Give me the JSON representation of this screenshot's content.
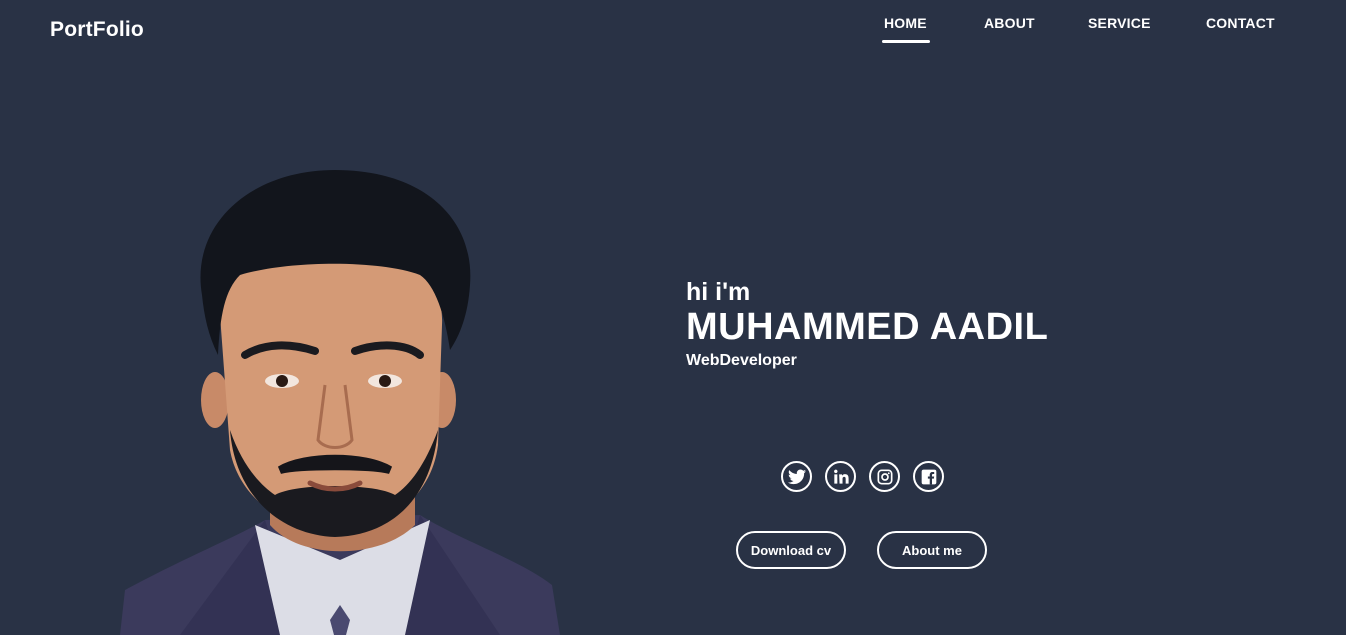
{
  "header": {
    "logo": "PortFolio"
  },
  "nav": {
    "items": [
      "HOME",
      "ABOUT",
      "SERVICE",
      "CONTACT"
    ],
    "active": "HOME"
  },
  "hero": {
    "greeting": "hi i'm",
    "name": "MUHAMMED AADIL",
    "role": "WebDeveloper",
    "photo_icon": "profile-photo"
  },
  "socials": [
    "twitter-icon",
    "linkedin-icon",
    "instagram-icon",
    "facebook-icon"
  ],
  "buttons": {
    "download_cv": "Download cv",
    "about_me": "About me"
  },
  "colors": {
    "background": "#293245",
    "text": "#ffffff",
    "suit": "#3b3a5c"
  }
}
